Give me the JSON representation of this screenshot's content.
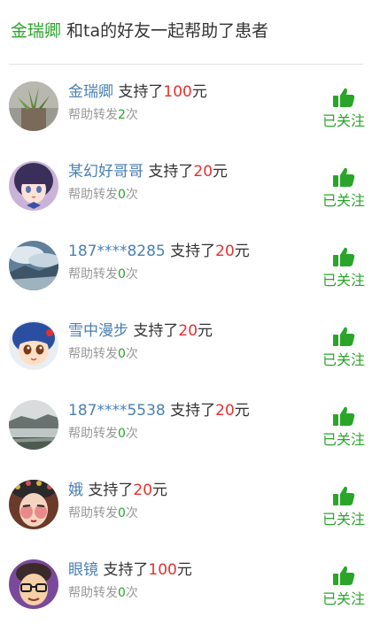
{
  "header": {
    "user_name": "金瑞卿",
    "text": " 和ta的好友一起帮助了患者"
  },
  "supporters": [
    {
      "name": "金瑞卿",
      "action": " 支持了",
      "amount": "100",
      "unit": "元",
      "forward_prefix": "帮助转发",
      "forward_count": "2",
      "forward_suffix": "次",
      "follow_label": "已关注",
      "avatar_icon": "plant-photo-avatar"
    },
    {
      "name": "某幻好哥哥",
      "action": " 支持了",
      "amount": "20",
      "unit": "元",
      "forward_prefix": "帮助转发",
      "forward_count": "0",
      "forward_suffix": "次",
      "follow_label": "已关注",
      "avatar_icon": "anime-girl-avatar"
    },
    {
      "name": "187****8285",
      "action": " 支持了",
      "amount": "20",
      "unit": "元",
      "forward_prefix": "帮助转发",
      "forward_count": "0",
      "forward_suffix": "次",
      "follow_label": "已关注",
      "avatar_icon": "sky-landscape-avatar"
    },
    {
      "name": "雪中漫步",
      "action": " 支持了",
      "amount": "20",
      "unit": "元",
      "forward_prefix": "帮助转发",
      "forward_count": "0",
      "forward_suffix": "次",
      "follow_label": "已关注",
      "avatar_icon": "cartoon-face-avatar"
    },
    {
      "name": "187****5538",
      "action": " 支持了",
      "amount": "20",
      "unit": "元",
      "forward_prefix": "帮助转发",
      "forward_count": "0",
      "forward_suffix": "次",
      "follow_label": "已关注",
      "avatar_icon": "lake-landscape-avatar"
    },
    {
      "name": "娥",
      "action": " 支持了",
      "amount": "20",
      "unit": "元",
      "forward_prefix": "帮助转发",
      "forward_count": "0",
      "forward_suffix": "次",
      "follow_label": "已关注",
      "avatar_icon": "opera-mask-avatar"
    },
    {
      "name": "眼镜",
      "action": " 支持了",
      "amount": "100",
      "unit": "元",
      "forward_prefix": "帮助转发",
      "forward_count": "0",
      "forward_suffix": "次",
      "follow_label": "已关注",
      "avatar_icon": "glasses-man-avatar"
    }
  ],
  "colors": {
    "brand_green": "#2aa52a",
    "name_blue": "#4a7fb5",
    "amount_red": "#e53030",
    "muted_gray": "#999999"
  }
}
